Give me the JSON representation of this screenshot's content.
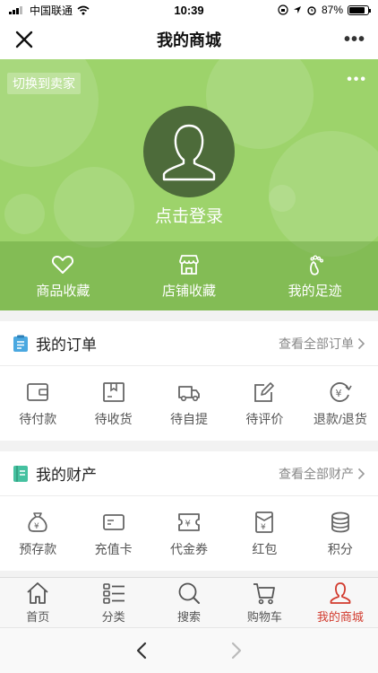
{
  "status": {
    "carrier": "中国联通",
    "time": "10:39",
    "battery": "87%",
    "battery_level": 0.87
  },
  "nav": {
    "title": "我的商城",
    "more": "•••"
  },
  "hero": {
    "switch_seller": "切换到卖家",
    "more": "•••",
    "login": "点击登录",
    "shortcuts": [
      "商品收藏",
      "店铺收藏",
      "我的足迹"
    ]
  },
  "orders": {
    "title": "我的订单",
    "link": "查看全部订单",
    "items": [
      "待付款",
      "待收货",
      "待自提",
      "待评价",
      "退款/退货"
    ]
  },
  "assets": {
    "title": "我的财产",
    "link": "查看全部财产",
    "items": [
      "预存款",
      "充值卡",
      "代金券",
      "红包",
      "积分"
    ]
  },
  "tabs": [
    "首页",
    "分类",
    "搜索",
    "购物车",
    "我的商城"
  ],
  "colors": {
    "hero": "#9dd36b",
    "active": "#d23b2e",
    "order_icon": "#4aa8e0",
    "asset_icon": "#45c1a0"
  }
}
